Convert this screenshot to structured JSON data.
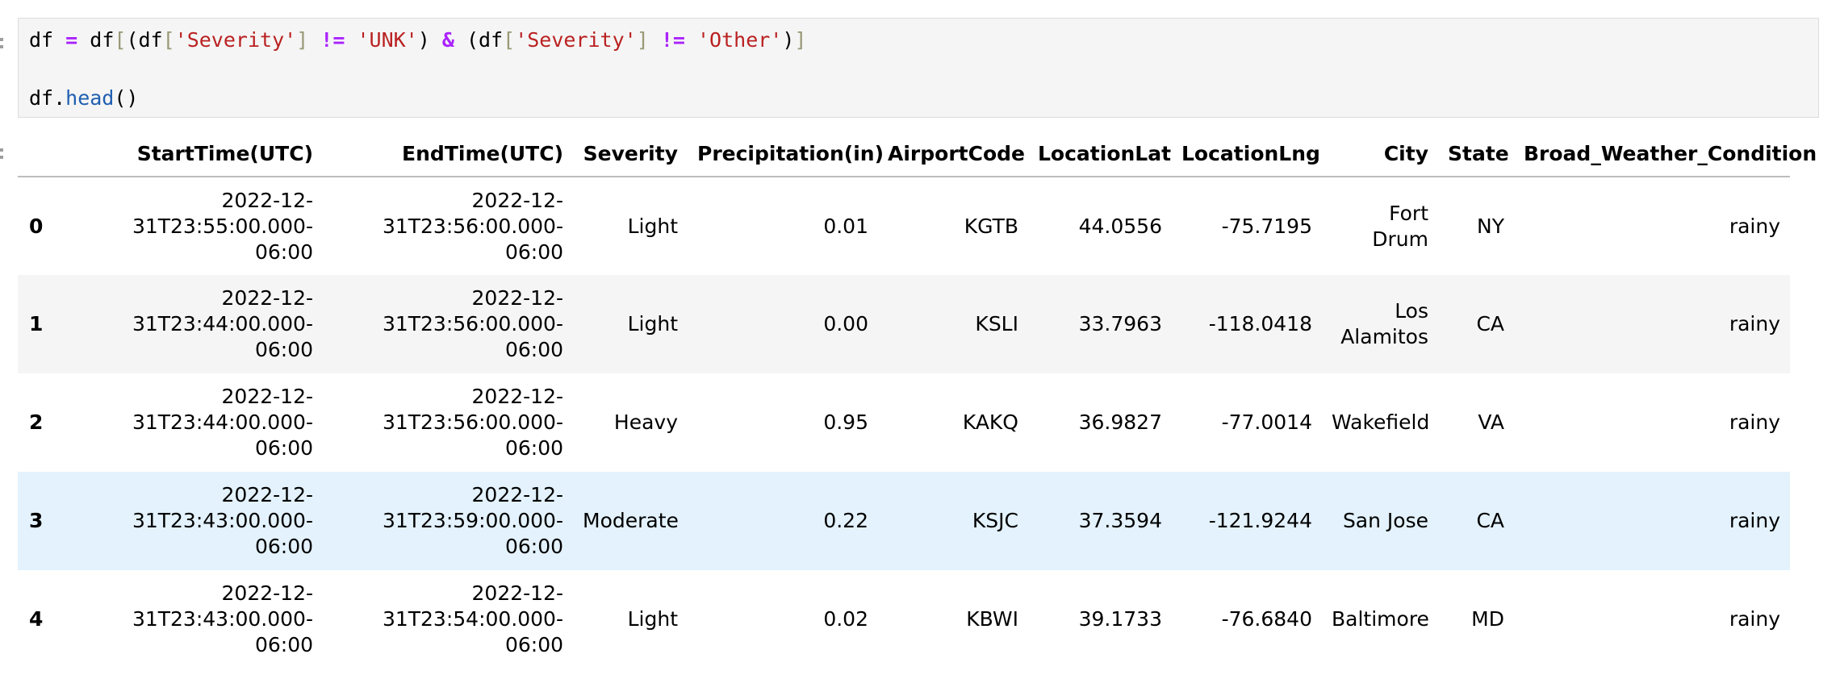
{
  "code_cell": {
    "line1": [
      {
        "t": "df ",
        "c": ""
      },
      {
        "t": "=",
        "c": "op"
      },
      {
        "t": " df",
        "c": ""
      },
      {
        "t": "[",
        "c": "br"
      },
      {
        "t": "(df",
        "c": ""
      },
      {
        "t": "[",
        "c": "br"
      },
      {
        "t": "'Severity'",
        "c": "str"
      },
      {
        "t": "]",
        "c": "br"
      },
      {
        "t": " ",
        "c": ""
      },
      {
        "t": "!=",
        "c": "op"
      },
      {
        "t": " ",
        "c": ""
      },
      {
        "t": "'UNK'",
        "c": "str"
      },
      {
        "t": ") ",
        "c": ""
      },
      {
        "t": "&",
        "c": "op"
      },
      {
        "t": " (df",
        "c": ""
      },
      {
        "t": "[",
        "c": "br"
      },
      {
        "t": "'Severity'",
        "c": "str"
      },
      {
        "t": "]",
        "c": "br"
      },
      {
        "t": " ",
        "c": ""
      },
      {
        "t": "!=",
        "c": "op"
      },
      {
        "t": " ",
        "c": ""
      },
      {
        "t": "'Other'",
        "c": "str"
      },
      {
        "t": ")",
        "c": ""
      },
      {
        "t": "]",
        "c": "br"
      }
    ],
    "line2": [
      {
        "t": "df.",
        "c": ""
      },
      {
        "t": "head",
        "c": "fn"
      },
      {
        "t": "()",
        "c": ""
      }
    ]
  },
  "dataframe": {
    "columns": [
      "",
      "StartTime(UTC)",
      "EndTime(UTC)",
      "Severity",
      "Precipitation(in)",
      "AirportCode",
      "LocationLat",
      "LocationLng",
      "City",
      "State",
      "Broad_Weather_Condition"
    ],
    "rows": [
      {
        "index": "0",
        "start": [
          "2022-12-",
          "31T23:55:00.000-",
          "06:00"
        ],
        "end": [
          "2022-12-",
          "31T23:56:00.000-",
          "06:00"
        ],
        "severity": "Light",
        "precip": "0.01",
        "airport": "KGTB",
        "lat": "44.0556",
        "lng": "-75.7195",
        "city": [
          "Fort",
          "Drum"
        ],
        "state": "NY",
        "cond": "rainy"
      },
      {
        "index": "1",
        "start": [
          "2022-12-",
          "31T23:44:00.000-",
          "06:00"
        ],
        "end": [
          "2022-12-",
          "31T23:56:00.000-",
          "06:00"
        ],
        "severity": "Light",
        "precip": "0.00",
        "airport": "KSLI",
        "lat": "33.7963",
        "lng": "-118.0418",
        "city": [
          "Los",
          "Alamitos"
        ],
        "state": "CA",
        "cond": "rainy"
      },
      {
        "index": "2",
        "start": [
          "2022-12-",
          "31T23:44:00.000-",
          "06:00"
        ],
        "end": [
          "2022-12-",
          "31T23:56:00.000-",
          "06:00"
        ],
        "severity": "Heavy",
        "precip": "0.95",
        "airport": "KAKQ",
        "lat": "36.9827",
        "lng": "-77.0014",
        "city": [
          "Wakefield"
        ],
        "state": "VA",
        "cond": "rainy"
      },
      {
        "index": "3",
        "start": [
          "2022-12-",
          "31T23:43:00.000-",
          "06:00"
        ],
        "end": [
          "2022-12-",
          "31T23:59:00.000-",
          "06:00"
        ],
        "severity": "Moderate",
        "precip": "0.22",
        "airport": "KSJC",
        "lat": "37.3594",
        "lng": "-121.9244",
        "city": [
          "San Jose"
        ],
        "state": "CA",
        "cond": "rainy"
      },
      {
        "index": "4",
        "start": [
          "2022-12-",
          "31T23:43:00.000-",
          "06:00"
        ],
        "end": [
          "2022-12-",
          "31T23:54:00.000-",
          "06:00"
        ],
        "severity": "Light",
        "precip": "0.02",
        "airport": "KBWI",
        "lat": "39.1733",
        "lng": "-76.6840",
        "city": [
          "Baltimore"
        ],
        "state": "MD",
        "cond": "rainy"
      }
    ],
    "hovered_row": 3
  }
}
